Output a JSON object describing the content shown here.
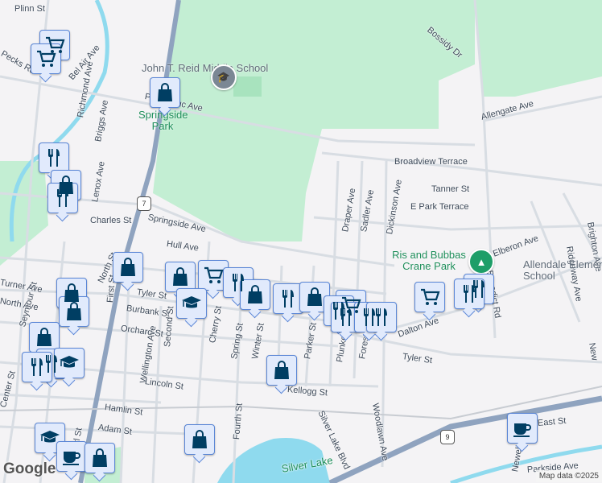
{
  "map": {
    "attribution": "Map data ©2025",
    "logo": "Google",
    "route_shields": [
      "7",
      "9"
    ],
    "pois": [
      {
        "name": "John T. Reid Middle School",
        "icon": "school-icon"
      },
      {
        "name": "Springside Park",
        "icon": "park"
      },
      {
        "name": "Ris and Bubbas Crane Park",
        "icon": "tree-icon"
      },
      {
        "name": "Allendale Elementary School",
        "icon": "school"
      }
    ],
    "streets": [
      "Plinn St",
      "Pecks Rd",
      "Bel Air Ave",
      "Pontoosuc Ave",
      "Richmond Ave",
      "Briggs Ave",
      "Lenox Ave",
      "Charles St",
      "Springside Ave",
      "Hull Ave",
      "Tyler St",
      "Burbank St",
      "Orchard St",
      "Turner Ave",
      "North Ave",
      "Seymour St",
      "North St",
      "First St",
      "Second St",
      "Wellington Ave",
      "Cherry St",
      "Spring St",
      "Winter St",
      "Fourth St",
      "Lincoln St",
      "Hamlin St",
      "Adam St",
      "N Pearl St",
      "Center St",
      "Kellogg St",
      "Parker St",
      "Plunkett St",
      "Forest Pl",
      "Woodlawn Ave",
      "Silver Lake Blvd",
      "Dalton Ave",
      "Tyler St",
      "Benedict Rd",
      "Allengate Ave",
      "Bossidy Dr",
      "Broadview Terrace",
      "Tanner St",
      "E Park Terrace",
      "Draper Ave",
      "Sadler Ave",
      "Dickinson Ave",
      "Elberon Ave",
      "Ridgeway Ave",
      "Brighton Ave",
      "East St",
      "Parkside Ave",
      "Newell St",
      "New",
      "Silver Lake"
    ],
    "markers": [
      "cart",
      "cart",
      "bag",
      "fork",
      "bag",
      "fork",
      "bag",
      "bag",
      "bag",
      "bag",
      "fork",
      "fork",
      "grad",
      "bag",
      "cart",
      "fork",
      "grad",
      "bag",
      "fork",
      "bag",
      "bag",
      "grad",
      "bag",
      "cart",
      "fork",
      "fork",
      "fork",
      "fork",
      "cart",
      "fork",
      "fork",
      "cup",
      "cup",
      "bag"
    ]
  },
  "colors": {
    "park": "#c3eed3",
    "water": "#8fdaee",
    "highway": "#8fa3bf",
    "marker_icon": "#003e63",
    "marker_bg": "#e1eafc"
  }
}
